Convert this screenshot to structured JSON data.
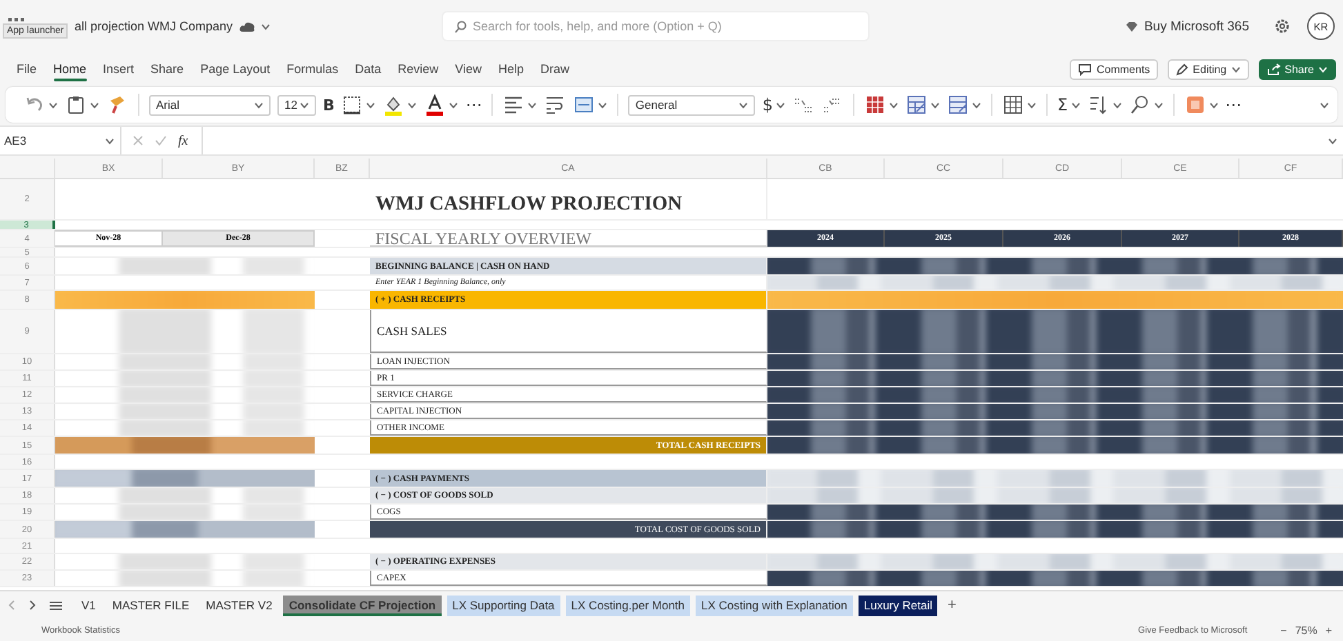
{
  "title_bar": {
    "app_launcher_tooltip": "App launcher",
    "document_title": "all projection WMJ Company",
    "search_placeholder": "Search for tools, help, and more (Option + Q)",
    "buy_label": "Buy Microsoft 365",
    "avatar": "KR"
  },
  "menu": [
    {
      "label": "File",
      "selected": false
    },
    {
      "label": "Home",
      "selected": true
    },
    {
      "label": "Insert",
      "selected": false
    },
    {
      "label": "Share",
      "selected": false
    },
    {
      "label": "Page Layout",
      "selected": false
    },
    {
      "label": "Formulas",
      "selected": false
    },
    {
      "label": "Data",
      "selected": false
    },
    {
      "label": "Review",
      "selected": false
    },
    {
      "label": "View",
      "selected": false
    },
    {
      "label": "Help",
      "selected": false
    },
    {
      "label": "Draw",
      "selected": false
    }
  ],
  "menu_buttons": {
    "comments": "Comments",
    "editing": "Editing",
    "share": "Share"
  },
  "toolbar": [
    [
      {
        "kind": "undo",
        "caret": true
      },
      {
        "kind": "paste",
        "caret": true
      },
      {
        "kind": "painter",
        "caret": false
      }
    ],
    [
      {
        "kind": "font-select",
        "value": "Arial"
      },
      {
        "kind": "size-select",
        "value": "12"
      },
      {
        "kind": "glyph",
        "text": "B",
        "caret": false
      },
      {
        "kind": "borders",
        "caret": true
      },
      {
        "kind": "fill",
        "caret": true
      },
      {
        "kind": "fontcolor",
        "caret": true
      },
      {
        "kind": "glyph",
        "text": "⋯",
        "caret": false
      }
    ],
    [
      {
        "kind": "align",
        "caret": true
      },
      {
        "kind": "wrap",
        "caret": false
      },
      {
        "kind": "merge",
        "caret": true
      }
    ],
    [
      {
        "kind": "format-select",
        "value": "General"
      },
      {
        "kind": "glyph",
        "text": "$",
        "caret": true
      },
      {
        "kind": "incdec",
        "caret": false
      },
      {
        "kind": "decdec",
        "caret": false
      }
    ],
    [
      {
        "kind": "condformat",
        "caret": true
      },
      {
        "kind": "table",
        "caret": true
      },
      {
        "kind": "styles",
        "caret": true
      }
    ],
    [
      {
        "kind": "insert",
        "caret": true
      }
    ],
    [
      {
        "kind": "glyph",
        "text": "Σ",
        "caret": true
      },
      {
        "kind": "sort",
        "caret": true
      },
      {
        "kind": "find",
        "caret": true
      }
    ],
    [
      {
        "kind": "addins",
        "caret": true
      },
      {
        "kind": "glyph",
        "text": "⋯",
        "caret": false
      }
    ]
  ],
  "formula_bar": {
    "cell": "AE3",
    "fx": "fx"
  },
  "columns": [
    "BX",
    "BY",
    "BZ",
    "CA",
    "CB",
    "CC",
    "CD",
    "CE",
    "CF"
  ],
  "rows": [
    {
      "num": "2",
      "kind": "title",
      "active": false,
      "label": "WMJ CASHFLOW PROJECTION"
    },
    {
      "num": "3",
      "kind": "spacer",
      "active": true
    },
    {
      "num": "4",
      "kind": "dates",
      "active": false,
      "months": [
        "Nov-28",
        "Dec-28"
      ],
      "label": "FISCAL YEARLY OVERVIEW",
      "years": [
        "2024",
        "2025",
        "2026",
        "2027",
        "2028"
      ]
    },
    {
      "num": "5",
      "kind": "spacer",
      "active": false
    },
    {
      "num": "6",
      "kind": "band-gray",
      "active": false,
      "label": "BEGINNING BALANCE | CASH ON HAND"
    },
    {
      "num": "7",
      "kind": "note",
      "active": false,
      "label": "Enter YEAR 1 Beginning Balance, only"
    },
    {
      "num": "8",
      "kind": "band-orange",
      "active": false,
      "label": "( + ) CASH RECEIPTS"
    },
    {
      "num": "9",
      "kind": "item-tall",
      "active": false,
      "label": "CASH SALES"
    },
    {
      "num": "10",
      "kind": "item",
      "active": false,
      "label": "LOAN INJECTION"
    },
    {
      "num": "11",
      "kind": "item",
      "active": false,
      "label": "PR 1"
    },
    {
      "num": "12",
      "kind": "item",
      "active": false,
      "label": "SERVICE CHARGE"
    },
    {
      "num": "13",
      "kind": "item",
      "active": false,
      "label": "CAPITAL INJECTION"
    },
    {
      "num": "14",
      "kind": "item",
      "active": false,
      "label": "OTHER INCOME"
    },
    {
      "num": "15",
      "kind": "total-gold",
      "active": false,
      "label": "TOTAL CASH RECEIPTS"
    },
    {
      "num": "16",
      "kind": "blank",
      "active": false
    },
    {
      "num": "17",
      "kind": "band-blue",
      "active": false,
      "label": "( − ) CASH PAYMENTS"
    },
    {
      "num": "18",
      "kind": "band-light",
      "active": false,
      "label": "( − ) COST OF GOODS SOLD"
    },
    {
      "num": "19",
      "kind": "item",
      "active": false,
      "label": "COGS"
    },
    {
      "num": "20",
      "kind": "total-dark",
      "active": false,
      "label": "TOTAL COST OF GOODS SOLD"
    },
    {
      "num": "21",
      "kind": "blank",
      "active": false
    },
    {
      "num": "22",
      "kind": "band-light",
      "active": false,
      "label": "( − ) OPERATING EXPENSES"
    },
    {
      "num": "23",
      "kind": "item",
      "active": false,
      "label": "CAPEX"
    }
  ],
  "sheet_tabs": [
    {
      "label": "V1",
      "selected": false
    },
    {
      "label": "MASTER FILE",
      "selected": false
    },
    {
      "label": "MASTER V2",
      "selected": false
    },
    {
      "label": "Consolidate CF Projection",
      "selected": true,
      "color": "#8c8c8c"
    },
    {
      "label": "LX Supporting Data",
      "selected": false,
      "color": "#c6daf2"
    },
    {
      "label": "LX Costing.per Month",
      "selected": false,
      "color": "#c6daf2"
    },
    {
      "label": "LX Costing with Explanation",
      "selected": false,
      "color": "#c6daf2"
    },
    {
      "label": "Luxury Retail",
      "selected": false,
      "color": "#0b1f5c"
    }
  ],
  "add_sheet": "+",
  "status_bar": {
    "left": "Workbook Statistics",
    "feedback": "Give Feedback to Microsoft",
    "zoom_out": "−",
    "zoom": "75%",
    "zoom_in": "+"
  }
}
